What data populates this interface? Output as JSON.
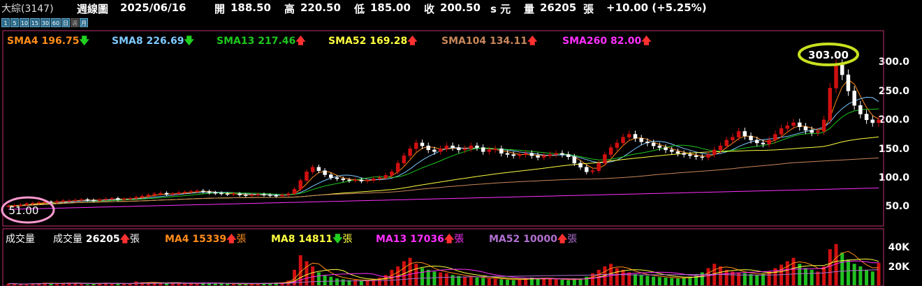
{
  "header": {
    "stock_name": "大綜(3147)",
    "chart_type": "週線圖",
    "date": "2025/06/16",
    "open_label": "開",
    "open": "188.50",
    "high_label": "高",
    "high": "220.50",
    "low_label": "低",
    "low": "185.00",
    "close_label": "收",
    "close": "200.50",
    "close_suffix": "s 元",
    "volume_label": "量",
    "volume": "26205",
    "volume_unit": "張",
    "change": "+10.00 (+5.25%)"
  },
  "periods": [
    "1",
    "5",
    "10",
    "15",
    "30",
    "60",
    "日",
    "週",
    "月"
  ],
  "price_legend": [
    {
      "name": "SMA4",
      "value": "196.75",
      "dir": "down",
      "color": "#ff8c1a"
    },
    {
      "name": "SMA8",
      "value": "226.69",
      "dir": "down",
      "color": "#7ec8ff"
    },
    {
      "name": "SMA13",
      "value": "217.46",
      "dir": "up",
      "color": "#1ec81e"
    },
    {
      "name": "SMA52",
      "value": "169.28",
      "dir": "up",
      "color": "#ffff40"
    },
    {
      "name": "SMA104",
      "value": "134.11",
      "dir": "up",
      "color": "#c8865a"
    },
    {
      "name": "SMA260",
      "value": "82.00",
      "dir": "up",
      "color": "#ff30ff"
    }
  ],
  "volume_legend": {
    "title": "成交量",
    "items": [
      {
        "name": "成交量",
        "value": "26205",
        "dir": "up",
        "unit": "張",
        "color": "#ffffff"
      },
      {
        "name": "MA4",
        "value": "15339",
        "dir": "up",
        "unit": "張",
        "color": "#ff8c1a"
      },
      {
        "name": "MA8",
        "value": "14811",
        "dir": "down",
        "unit": "張",
        "color": "#ffff40"
      },
      {
        "name": "MA13",
        "value": "17036",
        "dir": "up",
        "unit": "張",
        "color": "#ff30ff"
      },
      {
        "name": "MA52",
        "value": "10000",
        "dir": "up",
        "unit": "張",
        "color": "#b070d0"
      }
    ]
  },
  "annotations": {
    "max": "303.00",
    "min": "51.00"
  },
  "colors": {
    "up": "#d01010",
    "down": "#ffffff",
    "border": "#c03070",
    "max_circle": "#c8e020",
    "min_circle": "#ff9ad0"
  },
  "chart_data": [
    {
      "type": "candlestick",
      "y_ticks": [
        "300.0",
        "250.0",
        "200.0",
        "150.0",
        "100.0",
        "50.0"
      ],
      "ylim": [
        30,
        320
      ],
      "close_series": [
        51,
        52,
        53,
        55,
        56,
        57,
        58,
        57,
        59,
        60,
        60,
        61,
        62,
        61,
        60,
        62,
        63,
        64,
        62,
        63,
        64,
        66,
        68,
        70,
        72,
        73,
        71,
        72,
        74,
        75,
        76,
        77,
        76,
        74,
        73,
        72,
        71,
        72,
        70,
        69,
        70,
        71,
        70,
        69,
        68,
        70,
        72,
        80,
        95,
        110,
        118,
        112,
        105,
        100,
        98,
        96,
        95,
        96,
        94,
        95,
        98,
        100,
        104,
        110,
        125,
        138,
        150,
        160,
        155,
        148,
        145,
        150,
        155,
        152,
        148,
        150,
        155,
        152,
        145,
        148,
        150,
        142,
        140,
        138,
        140,
        142,
        138,
        135,
        138,
        140,
        142,
        140,
        136,
        125,
        118,
        110,
        112,
        125,
        140,
        152,
        160,
        170,
        175,
        168,
        162,
        160,
        155,
        152,
        148,
        145,
        142,
        140,
        138,
        136,
        135,
        140,
        148,
        155,
        165,
        170,
        180,
        172,
        165,
        160,
        158,
        165,
        175,
        185,
        190,
        195,
        188,
        182,
        178,
        180,
        200,
        255,
        295,
        278,
        250,
        225,
        210,
        200,
        195,
        200
      ]
    },
    {
      "type": "bar",
      "y_ticks": [
        "40K",
        "20K"
      ],
      "ylim": [
        0,
        60000
      ],
      "values": [
        2000,
        1500,
        1200,
        1800,
        2200,
        2500,
        3000,
        2000,
        1800,
        2500,
        3200,
        2800,
        1500,
        1200,
        1800,
        2500,
        3000,
        2200,
        1800,
        1500,
        2000,
        4500,
        3500,
        3000,
        2500,
        3200,
        2800,
        2500,
        2000,
        1800,
        2200,
        2500,
        3000,
        2800,
        2500,
        2000,
        1800,
        1500,
        1500,
        1800,
        2000,
        2200,
        2500,
        2800,
        3000,
        3500,
        5500,
        18000,
        35000,
        28000,
        22000,
        15000,
        12000,
        10000,
        8000,
        7000,
        6000,
        6500,
        5500,
        6000,
        7500,
        9000,
        12000,
        18000,
        22000,
        28000,
        32000,
        25000,
        20000,
        18000,
        16000,
        15000,
        14000,
        12000,
        11000,
        10000,
        9500,
        9000,
        8500,
        8000,
        7500,
        7000,
        6500,
        6000,
        7000,
        8000,
        9000,
        8500,
        8000,
        7500,
        7000,
        6500,
        6000,
        7000,
        8000,
        10000,
        14000,
        18000,
        22000,
        25000,
        20000,
        18000,
        15000,
        13000,
        12000,
        11000,
        10000,
        9500,
        9000,
        8500,
        8000,
        9000,
        10000,
        12000,
        15000,
        20000,
        25000,
        22000,
        18000,
        16000,
        15000,
        14000,
        13000,
        12000,
        14000,
        16000,
        20000,
        24000,
        28000,
        32000,
        25000,
        20000,
        18000,
        16000,
        22000,
        42000,
        48000,
        38000,
        30000,
        25000,
        22000,
        18000,
        16000,
        26205
      ]
    }
  ]
}
